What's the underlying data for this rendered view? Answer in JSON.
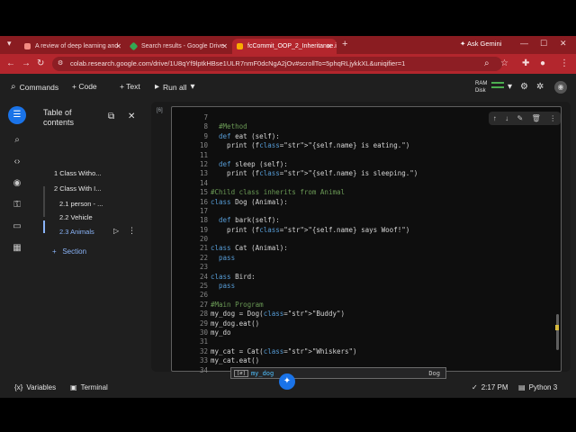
{
  "browser": {
    "tabs": [
      {
        "title": "A review of deep learning and",
        "color": "#f28b82"
      },
      {
        "title": "Search results - Google Drive",
        "color": "#34a853"
      },
      {
        "title": "fcCommit_OOP_2_Inheritance.i",
        "color": "#f9ab00"
      }
    ],
    "gemini_label": "Ask Gemini",
    "url": "colab.research.google.com/drive/1U8qYf9lptkHBse1ULR7nmF0dcNgA2jOv#scrollTo=5phqRLjykkXL&uniqifier=1"
  },
  "toolbar": {
    "commands": "Commands",
    "code": "+ Code",
    "text": "+ Text",
    "run_all": "Run all",
    "ram": "RAM",
    "disk": "Disk"
  },
  "toc": {
    "title": "Table of contents",
    "items": [
      "1 Class Witho...",
      "2 Class With I...",
      "2.1 person - ...",
      "2.2 Vehicle",
      "2.3 Animals"
    ],
    "add_section": "Section"
  },
  "cell": {
    "exec_count": "[6]",
    "lines": [
      {
        "n": "7",
        "t": ""
      },
      {
        "n": "8",
        "t": "  #Method"
      },
      {
        "n": "9",
        "t": "  def eat (self):"
      },
      {
        "n": "10",
        "t": "    print (f\"{self.name} is eating.\")"
      },
      {
        "n": "11",
        "t": ""
      },
      {
        "n": "12",
        "t": "  def sleep (self):"
      },
      {
        "n": "13",
        "t": "    print (f\"{self.name} is sleeping.\")"
      },
      {
        "n": "14",
        "t": ""
      },
      {
        "n": "15",
        "t": "#Child class inherits from Animal"
      },
      {
        "n": "16",
        "t": "class Dog (Animal):"
      },
      {
        "n": "17",
        "t": ""
      },
      {
        "n": "18",
        "t": "  def bark(self):"
      },
      {
        "n": "19",
        "t": "    print (f\"{self.name} says Woof!\")"
      },
      {
        "n": "20",
        "t": ""
      },
      {
        "n": "21",
        "t": "class Cat (Animal):"
      },
      {
        "n": "22",
        "t": "  pass"
      },
      {
        "n": "23",
        "t": ""
      },
      {
        "n": "24",
        "t": "class Bird:"
      },
      {
        "n": "25",
        "t": "  pass"
      },
      {
        "n": "26",
        "t": ""
      },
      {
        "n": "27",
        "t": "#Main Program"
      },
      {
        "n": "28",
        "t": "my_dog = Dog(\"Buddy\")"
      },
      {
        "n": "29",
        "t": "my_dog.eat()"
      },
      {
        "n": "30",
        "t": "my_do"
      },
      {
        "n": "31",
        "t": ""
      },
      {
        "n": "32",
        "t": "my_cat = Cat(\"Whiskers\")"
      },
      {
        "n": "33",
        "t": "my_cat.eat()"
      },
      {
        "n": "34",
        "t": ""
      }
    ],
    "suggestion": {
      "badge": "[ø]",
      "name": "my_dog",
      "type": "Dog"
    }
  },
  "status": {
    "variables": "Variables",
    "terminal": "Terminal",
    "time": "2:17 PM",
    "runtime": "Python 3"
  },
  "colors": {
    "accent": "#1a73e8",
    "chrome": "#b3262d",
    "link": "#8ab4f8"
  }
}
